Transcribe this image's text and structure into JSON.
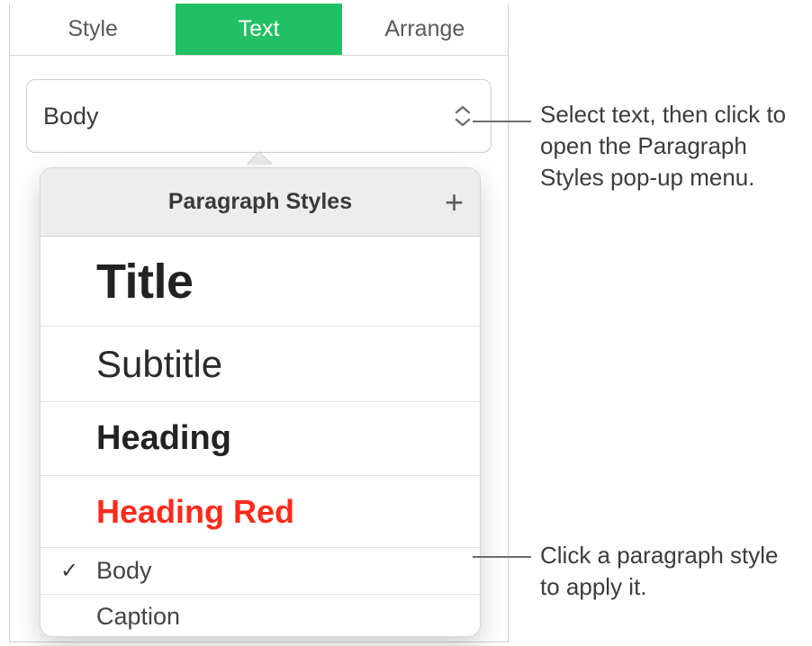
{
  "tabs": {
    "style": "Style",
    "text": "Text",
    "arrange": "Arrange"
  },
  "paragraph_selector": {
    "current": "Body"
  },
  "popover": {
    "title": "Paragraph Styles",
    "add_label": "+",
    "items": [
      {
        "label": "Title",
        "selected": false
      },
      {
        "label": "Subtitle",
        "selected": false
      },
      {
        "label": "Heading",
        "selected": false
      },
      {
        "label": "Heading Red",
        "selected": false
      },
      {
        "label": "Body",
        "selected": true
      },
      {
        "label": "Caption",
        "selected": false
      }
    ]
  },
  "annotations": {
    "a1": "Select text, then click to open the Paragraph Styles pop-up menu.",
    "a2": "Click a paragraph style to apply it."
  },
  "checkmark": "✓"
}
